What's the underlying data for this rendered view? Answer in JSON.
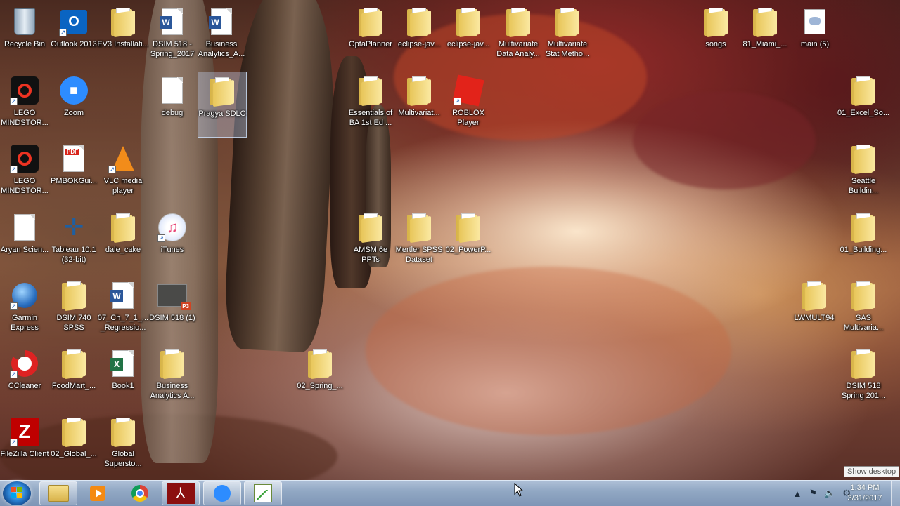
{
  "desktop": {
    "icons": [
      {
        "label": "Recycle Bin"
      },
      {
        "label": "Outlook 2013"
      },
      {
        "label": "EV3 Installati..."
      },
      {
        "label": "DSIM 518 - Spring_2017"
      },
      {
        "label": "Business Analytics_A..."
      },
      {
        "label": "LEGO MINDSTOR..."
      },
      {
        "label": "Zoom"
      },
      {
        "label": "debug"
      },
      {
        "label": "Pragya SDLC"
      },
      {
        "label": "LEGO MINDSTOR..."
      },
      {
        "label": "PMBOKGui..."
      },
      {
        "label": "VLC media player"
      },
      {
        "label": "Aryan Scien..."
      },
      {
        "label": "Tableau 10.1 (32-bit)"
      },
      {
        "label": "dale_cake"
      },
      {
        "label": "iTunes"
      },
      {
        "label": "Garmin Express"
      },
      {
        "label": "DSIM 740 SPSS"
      },
      {
        "label": "07_Ch_7_1_..._Regressio..."
      },
      {
        "label": "DSIM 518 (1)"
      },
      {
        "label": "CCleaner"
      },
      {
        "label": "FoodMart_..."
      },
      {
        "label": "Book1"
      },
      {
        "label": "Business Analytics A..."
      },
      {
        "label": "FileZilla Client"
      },
      {
        "label": "02_Global_..."
      },
      {
        "label": "Global Supersto..."
      },
      {
        "label": "OptaPlanner"
      },
      {
        "label": "eclipse-jav..."
      },
      {
        "label": "eclipse-jav..."
      },
      {
        "label": "Multivariate Data Analy..."
      },
      {
        "label": "Multivariate Stat Metho..."
      },
      {
        "label": "Essentials of BA 1st Ed ..."
      },
      {
        "label": "Multivariat..."
      },
      {
        "label": "ROBLOX Player"
      },
      {
        "label": "AMSM 6e PPTs"
      },
      {
        "label": "Mertler SPSS Dataset"
      },
      {
        "label": "02_PowerP..."
      },
      {
        "label": "02_Spring_..."
      },
      {
        "label": "songs"
      },
      {
        "label": "81_Miami_..."
      },
      {
        "label": "main (5)"
      },
      {
        "label": "01_Excel_So..."
      },
      {
        "label": "Seattle Buildin..."
      },
      {
        "label": "01_Building..."
      },
      {
        "label": "LWMULT94"
      },
      {
        "label": "SAS Multivaria..."
      },
      {
        "label": "DSIM 518 Spring 201..."
      }
    ],
    "selected": "Pragya SDLC"
  },
  "taskbar": {
    "pinned": [
      "Windows Explorer",
      "Windows Media Player",
      "Google Chrome",
      "Adobe Acrobat",
      "Zoom",
      "Chart app"
    ],
    "clock_time": "1:34 PM",
    "clock_date": "3/31/2017",
    "tooltip": "Show desktop"
  },
  "colors": {
    "taskbar": "#9fb4cf",
    "folder": "#e8c65a",
    "selection": "#c8dcff"
  }
}
